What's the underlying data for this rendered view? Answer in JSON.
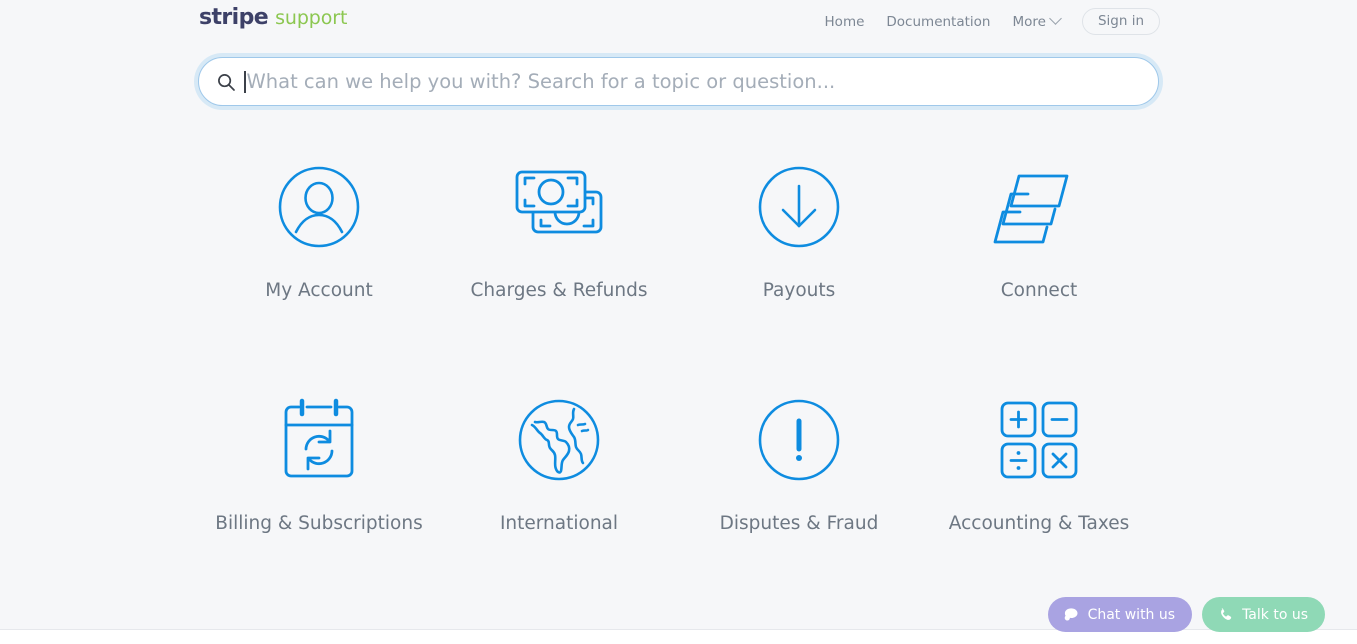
{
  "header": {
    "brand": {
      "name": "stripe",
      "product": "support"
    },
    "nav": [
      {
        "label": "Home",
        "name": "nav-link-home"
      },
      {
        "label": "Documentation",
        "name": "nav-link-documentation"
      },
      {
        "label": "More",
        "name": "nav-link-more",
        "icon": "chevron-down-icon"
      }
    ],
    "sign_in_label": "Sign in"
  },
  "search": {
    "placeholder": "What can we help you with? Search for a topic or question...",
    "value": "",
    "icon": "search-icon",
    "focused": true
  },
  "categories": [
    {
      "label": "My Account",
      "icon": "user-circle-icon"
    },
    {
      "label": "Charges & Refunds",
      "icon": "banknotes-icon"
    },
    {
      "label": "Payouts",
      "icon": "arrow-down-circle-icon"
    },
    {
      "label": "Connect",
      "icon": "layers-icon"
    },
    {
      "label": "Billing & Subscriptions",
      "icon": "calendar-refresh-icon"
    },
    {
      "label": "International",
      "icon": "globe-icon"
    },
    {
      "label": "Disputes & Fraud",
      "icon": "exclamation-circle-icon"
    },
    {
      "label": "Accounting & Taxes",
      "icon": "calculator-operators-icon"
    }
  ],
  "widgets": [
    {
      "label": "Chat with us",
      "icon": "speech-bubble-icon",
      "color": "#a9a3e2"
    },
    {
      "label": "Talk to us",
      "icon": "phone-icon",
      "color": "#8fd9b6"
    }
  ],
  "colors": {
    "page_background": "#f6f7f9",
    "icon_blue": "#0e8ce0",
    "label_gray": "#6d7783",
    "brand_dark": "#3d4168",
    "brand_green": "#8cc751",
    "search_focus_ring": "#8ac4f0"
  }
}
